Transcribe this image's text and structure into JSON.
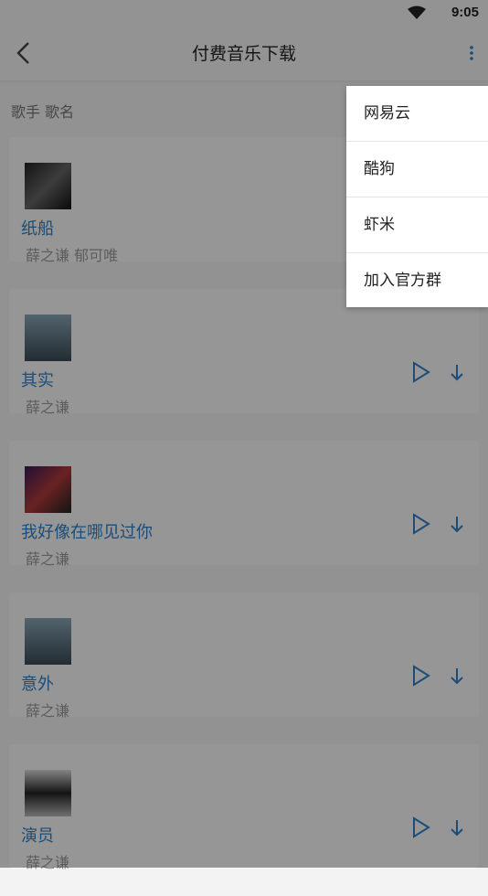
{
  "status": {
    "time": "9:05"
  },
  "header": {
    "title": "付费音乐下载"
  },
  "search": {
    "placeholder": "歌手 歌名"
  },
  "songs": [
    {
      "title": "纸船",
      "artist": "薛之谦 郁可唯"
    },
    {
      "title": "其实",
      "artist": "薛之谦"
    },
    {
      "title": "我好像在哪见过你",
      "artist": "薛之谦"
    },
    {
      "title": "意外",
      "artist": "薛之谦"
    },
    {
      "title": "演员",
      "artist": "薛之谦"
    }
  ],
  "menu": {
    "items": [
      "网易云",
      "酷狗",
      "虾米",
      "加入官方群"
    ]
  },
  "colors": {
    "accent": "#2f7fc9",
    "overlay": "rgba(0,0,0,0.4)"
  }
}
